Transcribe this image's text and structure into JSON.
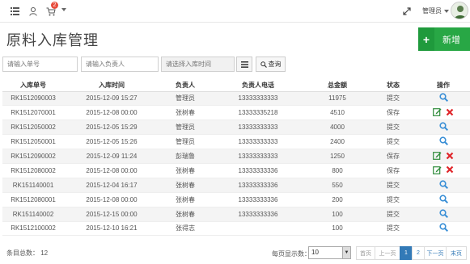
{
  "topbar": {
    "cart_badge": "2",
    "user_name": "管理员"
  },
  "page": {
    "title": "原料入库管理",
    "add_label": "新增"
  },
  "filters": {
    "order_no_placeholder": "请输入单号",
    "person_placeholder": "请输入负责人",
    "time_placeholder": "请选择入库时间",
    "search_label": "查询"
  },
  "table": {
    "headers": [
      "入库单号",
      "入库时间",
      "负责人",
      "负责人电话",
      "总金额",
      "状态",
      "操作"
    ],
    "rows": [
      {
        "no": "RK1512090003",
        "time": "2015-12-09 15:27",
        "person": "管理员",
        "phone": "13333333333",
        "amount": "11975",
        "status": "提交",
        "actions": [
          "view"
        ]
      },
      {
        "no": "RK1512070001",
        "time": "2015-12-08 00:00",
        "person": "张树春",
        "phone": "13333335218",
        "amount": "4510",
        "status": "保存",
        "actions": [
          "edit",
          "delete"
        ]
      },
      {
        "no": "RK1512050002",
        "time": "2015-12-05 15:29",
        "person": "管理员",
        "phone": "13333333333",
        "amount": "4000",
        "status": "提交",
        "actions": [
          "view"
        ]
      },
      {
        "no": "RK1512050001",
        "time": "2015-12-05 15:26",
        "person": "管理员",
        "phone": "13333333333",
        "amount": "2400",
        "status": "提交",
        "actions": [
          "view"
        ]
      },
      {
        "no": "RK1512090002",
        "time": "2015-12-09 11:24",
        "person": "彭瑞鲁",
        "phone": "13333333333",
        "amount": "1250",
        "status": "保存",
        "actions": [
          "edit",
          "delete"
        ]
      },
      {
        "no": "RK1512080002",
        "time": "2015-12-08 00:00",
        "person": "张树春",
        "phone": "13333333336",
        "amount": "800",
        "status": "保存",
        "actions": [
          "edit",
          "delete"
        ]
      },
      {
        "no": "RK151140001",
        "time": "2015-12-04 16:17",
        "person": "张树春",
        "phone": "13333333336",
        "amount": "550",
        "status": "提交",
        "actions": [
          "view"
        ]
      },
      {
        "no": "RK1512080001",
        "time": "2015-12-08 00:00",
        "person": "张树春",
        "phone": "13333333336",
        "amount": "200",
        "status": "提交",
        "actions": [
          "view"
        ]
      },
      {
        "no": "RK151140002",
        "time": "2015-12-15 00:00",
        "person": "张树春",
        "phone": "13333333336",
        "amount": "100",
        "status": "提交",
        "actions": [
          "view"
        ]
      },
      {
        "no": "RK1512100002",
        "time": "2015-12-10 16:21",
        "person": "张得志",
        "phone": "",
        "amount": "100",
        "status": "提交",
        "actions": [
          "view"
        ]
      }
    ]
  },
  "footer": {
    "total_label": "条目总数： 12",
    "per_page_label": "每页显示数：",
    "per_page_value": "10",
    "pager": [
      "首页",
      "上一页",
      "1",
      "2",
      "下一页",
      "末页"
    ]
  },
  "colors": {
    "accent_green": "#28a745",
    "pager_blue": "#337ab7",
    "delete_red": "#e0262b",
    "view_blue": "#3a8fd6"
  }
}
